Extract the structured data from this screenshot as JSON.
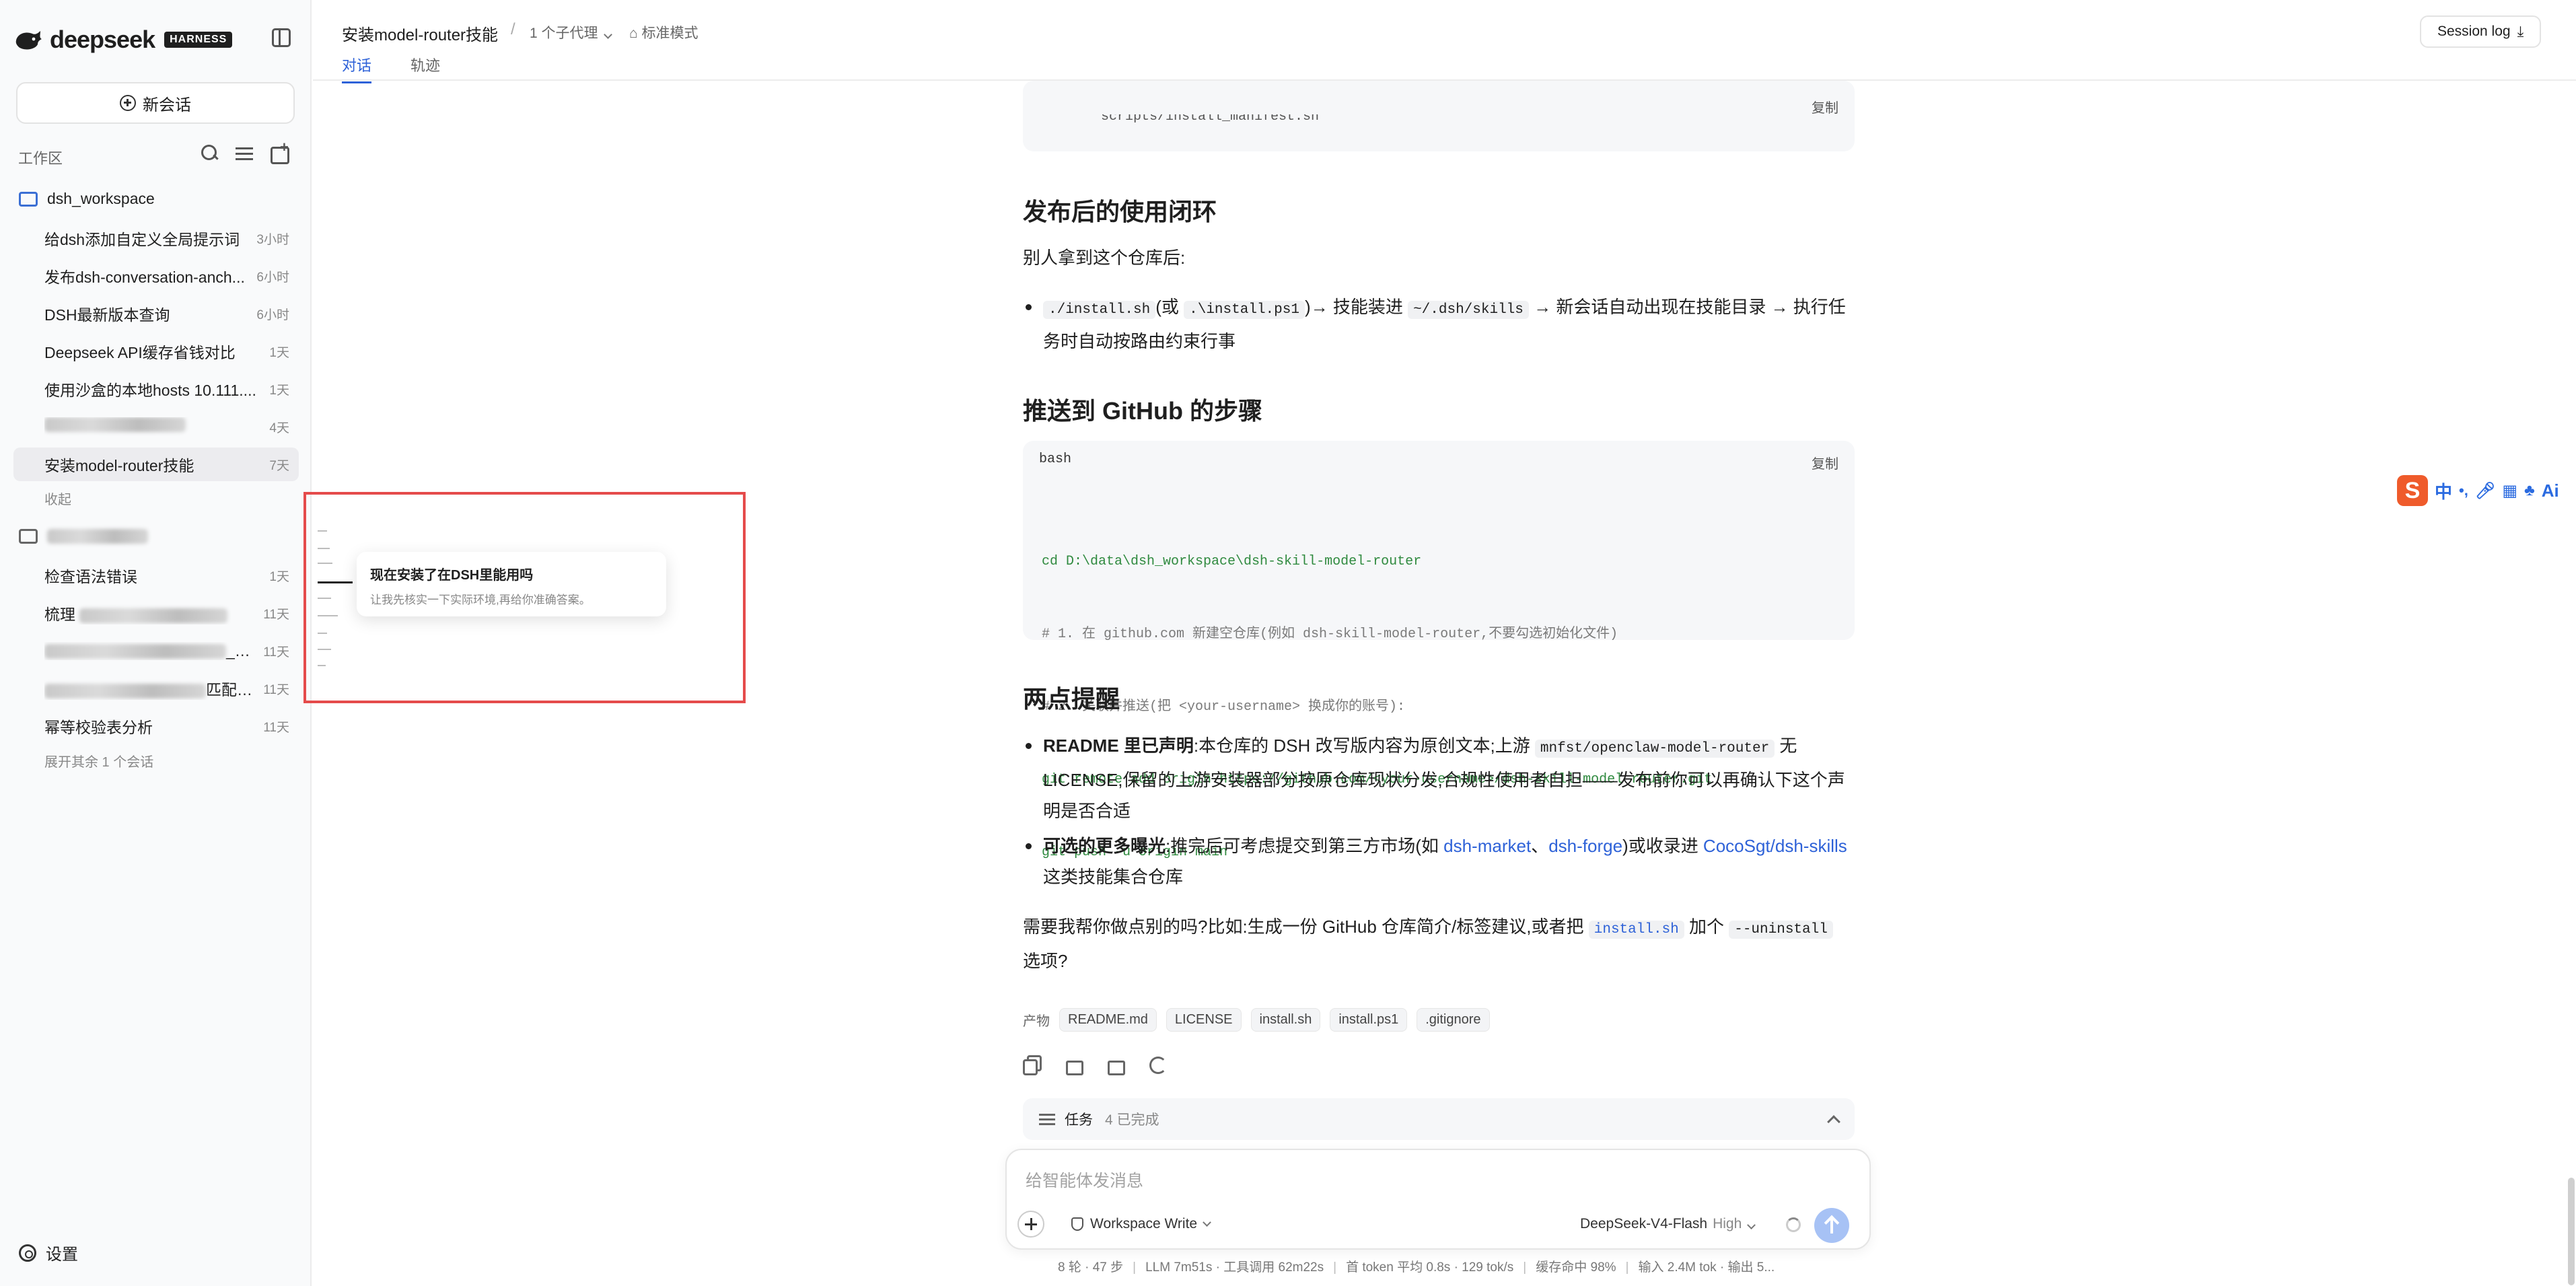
{
  "app": {
    "logo_text": "deepseek",
    "logo_badge": "HARNESS"
  },
  "sidebar": {
    "new_chat": "新会话",
    "workspace_label": "工作区",
    "folder1": "dsh_workspace",
    "convs1": [
      {
        "title": "给dsh添加自定义全局提示词",
        "time": "3小时"
      },
      {
        "title": "发布dsh-conversation-anch...",
        "time": "6小时"
      },
      {
        "title": "DSH最新版本查询",
        "time": "6小时"
      },
      {
        "title": "Deepseek API缓存省钱对比",
        "time": "1天"
      },
      {
        "title": "使用沙盒的本地hosts 10.111....",
        "time": "1天"
      },
      {
        "title": "",
        "time": "4天"
      },
      {
        "title": "安装model-router技能",
        "time": "7天"
      }
    ],
    "collapse": "收起",
    "convs2": [
      {
        "title": "检查语法错误",
        "time": "1天"
      },
      {
        "title": "梳理",
        "time": "11天"
      },
      {
        "title": "_PJ...",
        "time": "11天"
      },
      {
        "title": "匹配分析",
        "time": "11天"
      },
      {
        "title": "幂等校验表分析",
        "time": "11天"
      }
    ],
    "expand_more": "展开其余 1 个会话",
    "settings": "设置"
  },
  "header": {
    "title": "安装model-router技能",
    "sep": "/",
    "sub_agent": "1 个子代理",
    "mode": "标准模式",
    "tabs": [
      "对话",
      "轨迹"
    ],
    "session_log": "Session log"
  },
  "content": {
    "copy": "复制",
    "prev_code_tail": "scripts/install_manifest.sh",
    "h_usage": "发布后的使用闭环",
    "p_usage": "别人拿到这个仓库后:",
    "b_usage": {
      "code1": "./install.sh",
      "t1": "(或 ",
      "code2": ".\\install.ps1",
      "t2": ")→ 技能装进 ",
      "code3": "~/.dsh/skills",
      "t3": " → 新会话自动出现在技能目录 → 执行任务时自动按路由约束行事"
    },
    "h_push": "推送到 GitHub 的步骤",
    "code_lang": "bash",
    "code_lines": [
      "cd D:\\data\\dsh_workspace\\dsh-skill-model-router",
      "# 1. 在 github.com 新建空仓库(例如 dsh-skill-model-router,不要勾选初始化文件)",
      "# 2. 关联并推送(把 <your-username> 换成你的账号):",
      "git remote add origin https://github.com/<your-username>/dsh-skill-model-router.git",
      "git push -u origin main"
    ],
    "h_tips": "两点提醒",
    "tip1": {
      "bold": "README 里已声明",
      "t1": ":本仓库的 DSH 改写版内容为原创文本;上游 ",
      "code": "mnfst/openclaw-model-router",
      "t2": " 无 LICENSE,保留的上游安装器部分按原仓库现状分发,合规性使用者自担——发布前你可以再确认下这个声明是否合适"
    },
    "tip2": {
      "bold": "可选的更多曝光",
      "t1": ":推完后可考虑提交到第三方市场(如 ",
      "l1": "dsh-market",
      "t2": "、",
      "l2": "dsh-forge",
      "t3": ")或收录进 ",
      "l3": "CocoSgt/dsh-skills",
      "t4": " 这类技能集合仓库"
    },
    "closing": {
      "t1": "需要我帮你做点别的吗?比如:生成一份 GitHub 仓库简介/标签建议,或者把 ",
      "code1": "install.sh",
      "t2": " 加个 ",
      "code2": "--uninstall",
      "t3": " 选项?"
    },
    "artifacts_label": "产物",
    "artifacts": [
      "README.md",
      "LICENSE",
      "install.sh",
      "install.ps1",
      ".gitignore"
    ],
    "tasks_label": "任务",
    "tasks_count": "4 已完成"
  },
  "composer": {
    "placeholder": "给智能体发消息",
    "workspace_write": "Workspace Write",
    "model": "DeepSeek-V4-Flash",
    "level": "High"
  },
  "status_bar": [
    "8 轮 · 47 步",
    "LLM 7m51s · 工具调用 62m22s",
    "首 token 平均 0.8s · 129 tok/s",
    "缓存命中 98%",
    "输入 2.4M tok · 输出 5..."
  ],
  "tooltip": {
    "title": "现在安装了在DSH里能用吗",
    "desc": "让我先核实一下实际环境,再给你准确答案。"
  },
  "ime": {
    "label": "中",
    "ai": "Ai"
  }
}
